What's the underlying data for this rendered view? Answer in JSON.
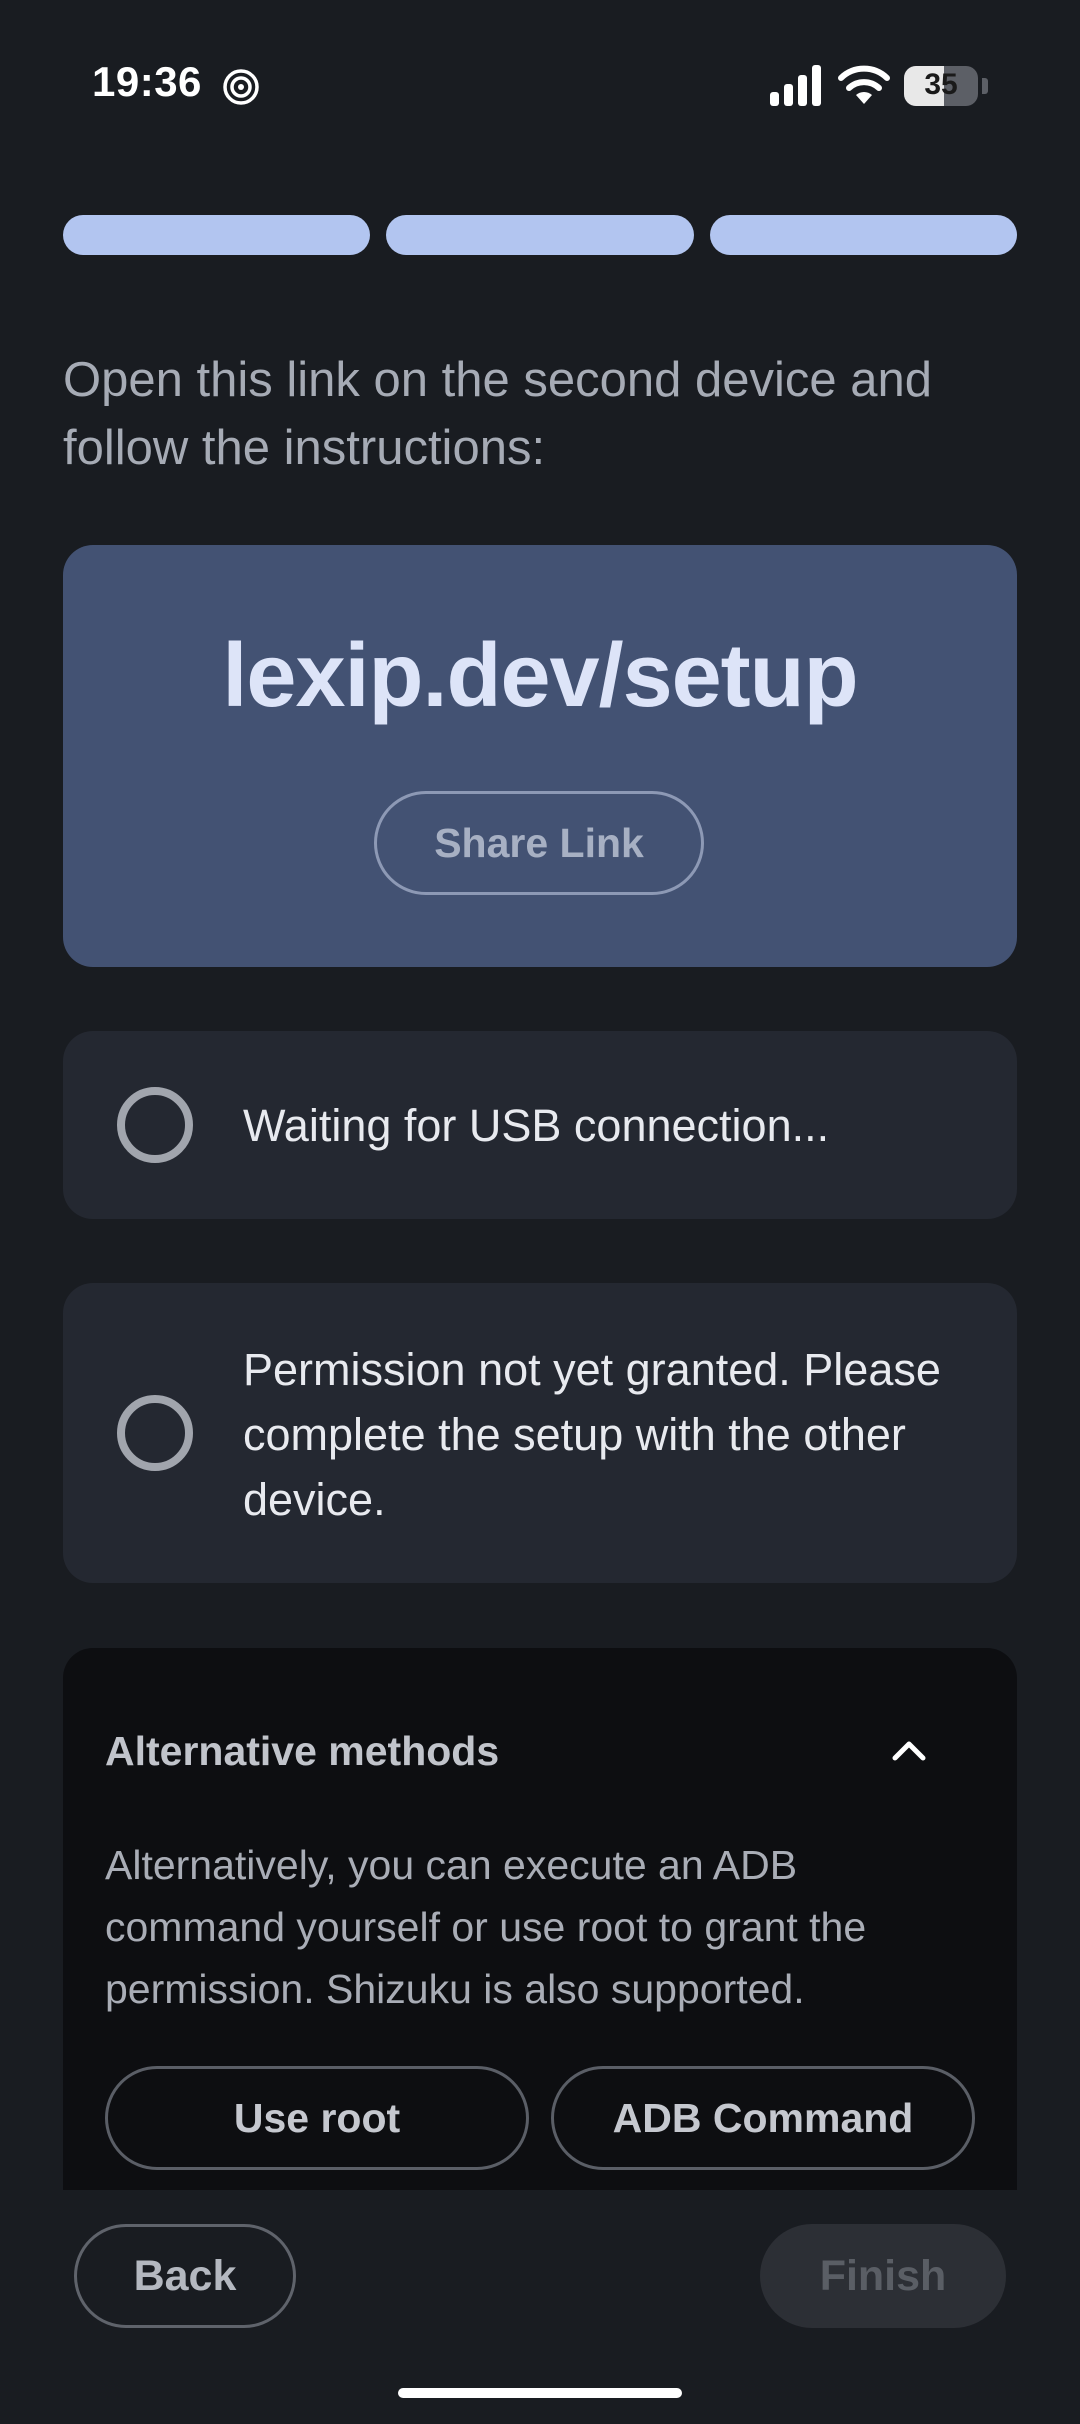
{
  "status_bar": {
    "time": "19:36",
    "app_icon": "spiral-icon",
    "signal_icon": "cellular-signal-icon",
    "wifi_icon": "wifi-icon",
    "battery_level": "35"
  },
  "progress": {
    "steps_total": 3,
    "steps_completed": 3,
    "color": "#b2c5f0"
  },
  "instruction": "Open this link on the second device and follow the instructions:",
  "link_card": {
    "url": "lexip.dev/setup",
    "share_label": "Share Link",
    "background": "#435273"
  },
  "usb_status": {
    "text": "Waiting for USB connection...",
    "icon": "pending-circle-icon"
  },
  "permission_status": {
    "text": "Permission not yet granted. Please complete the setup with the other device.",
    "icon": "pending-circle-icon"
  },
  "alternative": {
    "title": "Alternative methods",
    "icon": "chevron-up-icon",
    "description": "Alternatively, you can execute an ADB command yourself or use root to grant the permission. Shizuku is also supported.",
    "use_root_label": "Use root",
    "adb_label": "ADB Command"
  },
  "navigation": {
    "back_label": "Back",
    "finish_label": "Finish"
  }
}
